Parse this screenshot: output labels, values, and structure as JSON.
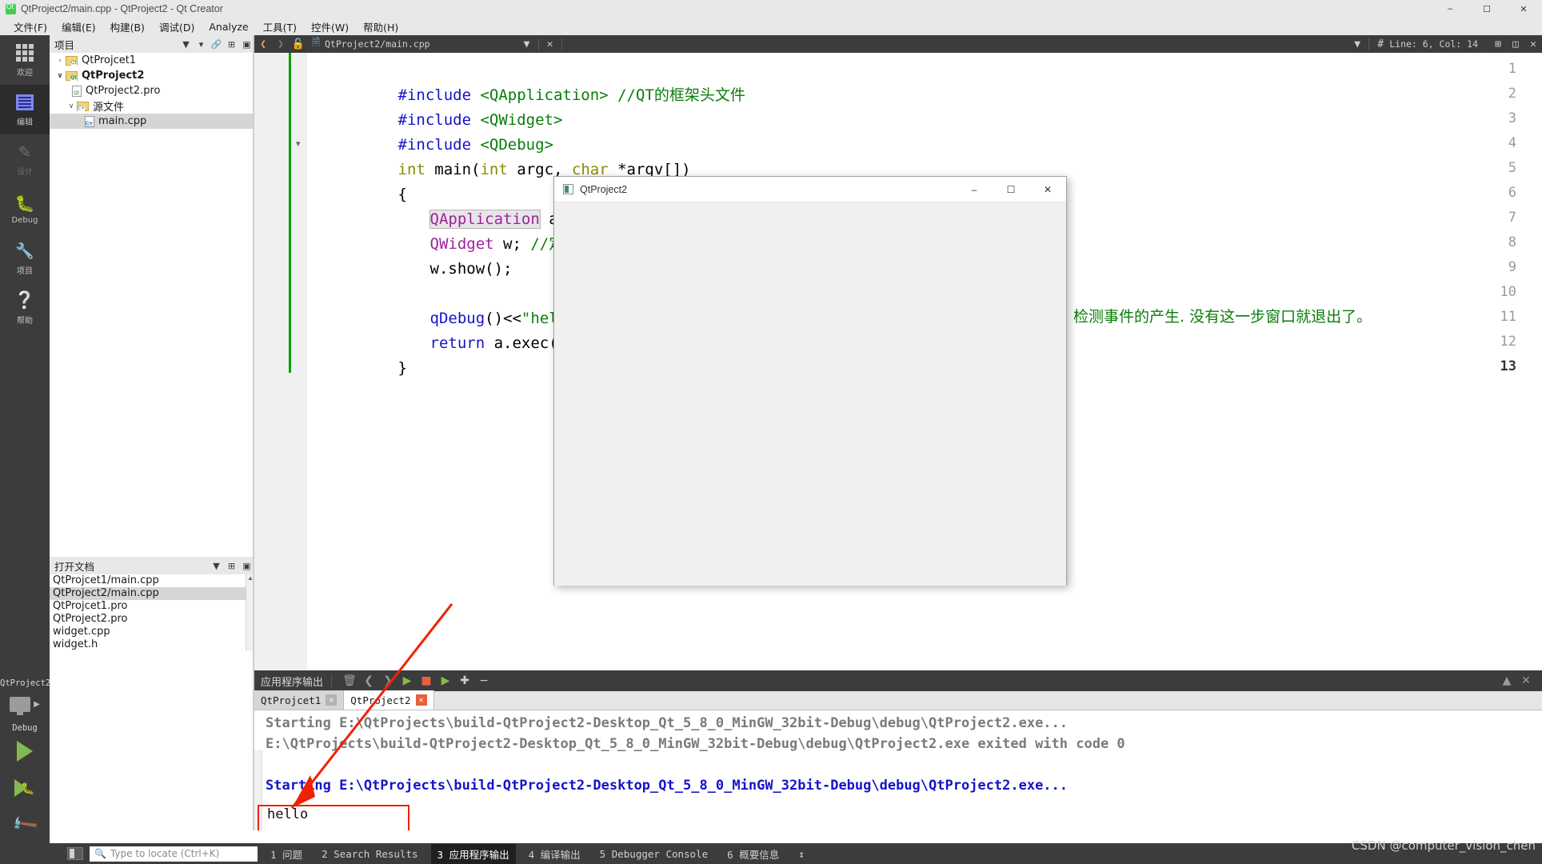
{
  "window": {
    "title": "QtProject2/main.cpp - QtProject2 - Qt Creator",
    "minimize": "–",
    "maximize": "☐",
    "close": "✕"
  },
  "menubar": [
    {
      "label": "文件(F)"
    },
    {
      "label": "编辑(E)"
    },
    {
      "label": "构建(B)"
    },
    {
      "label": "调试(D)"
    },
    {
      "label": "Analyze"
    },
    {
      "label": "工具(T)"
    },
    {
      "label": "控件(W)"
    },
    {
      "label": "帮助(H)"
    }
  ],
  "modebar": {
    "items": [
      {
        "label": "欢迎",
        "icon": "grid-icon"
      },
      {
        "label": "编辑",
        "icon": "edit-icon"
      },
      {
        "label": "设计",
        "icon": "pencil-icon"
      },
      {
        "label": "Debug",
        "icon": "bug-icon"
      },
      {
        "label": "项目",
        "icon": "wrench-icon"
      },
      {
        "label": "帮助",
        "icon": "question-icon"
      }
    ],
    "kit": {
      "project": "QtProject2",
      "config": "Debug"
    }
  },
  "projects_panel": {
    "title": "项目",
    "tree": [
      {
        "label": "QtProjcet1",
        "depth": 0,
        "arrow": "›",
        "icon": "qt-folder-icon",
        "bold": false,
        "selected": false
      },
      {
        "label": "QtProject2",
        "depth": 0,
        "arrow": "∨",
        "icon": "qt-folder-icon",
        "bold": true,
        "selected": false
      },
      {
        "label": "QtProject2.pro",
        "depth": 1,
        "arrow": "",
        "icon": "pro-file-icon",
        "bold": false,
        "selected": false
      },
      {
        "label": "源文件",
        "depth": 1,
        "arrow": "∨",
        "icon": "src-folder-icon",
        "bold": false,
        "selected": false
      },
      {
        "label": "main.cpp",
        "depth": 2,
        "arrow": "",
        "icon": "cpp-file-icon",
        "bold": false,
        "selected": true
      }
    ]
  },
  "opendocs_panel": {
    "title": "打开文档",
    "items": [
      {
        "label": "QtProjcet1/main.cpp",
        "selected": false
      },
      {
        "label": "QtProject2/main.cpp",
        "selected": true
      },
      {
        "label": "QtProjcet1.pro",
        "selected": false
      },
      {
        "label": "QtProject2.pro",
        "selected": false
      },
      {
        "label": "widget.cpp",
        "selected": false
      },
      {
        "label": "widget.h",
        "selected": false
      }
    ]
  },
  "editor_toolbar": {
    "current_file": "QtProject2/main.cpp",
    "line_col": "Line: 6, Col: 14",
    "hash": "#"
  },
  "editor": {
    "lines": [
      {
        "n": "1",
        "fold": false,
        "cur": false
      },
      {
        "n": "2",
        "fold": false,
        "cur": false
      },
      {
        "n": "3",
        "fold": false,
        "cur": false
      },
      {
        "n": "4",
        "fold": true,
        "cur": false
      },
      {
        "n": "5",
        "fold": false,
        "cur": false
      },
      {
        "n": "6",
        "fold": false,
        "cur": false
      },
      {
        "n": "7",
        "fold": false,
        "cur": false
      },
      {
        "n": "8",
        "fold": false,
        "cur": false
      },
      {
        "n": "9",
        "fold": false,
        "cur": false
      },
      {
        "n": "10",
        "fold": false,
        "cur": false
      },
      {
        "n": "11",
        "fold": false,
        "cur": false
      },
      {
        "n": "12",
        "fold": false,
        "cur": false
      },
      {
        "n": "13",
        "fold": false,
        "cur": true
      }
    ],
    "code": {
      "l1_inc": "#include",
      "l1_hdr": " <QApplication> ",
      "l1_cmt": "//QT的框架头文件",
      "l2_inc": "#include",
      "l2_hdr": " <QWidget>",
      "l3_inc": "#include",
      "l3_hdr": " <QDebug>",
      "l4_int": "int",
      "l4_main": " main(",
      "l4_int2": "int",
      "l4_argc": " argc, ",
      "l4_char": "char",
      "l4_argv": " *argv[])",
      "l5": "{",
      "l6_cls": "QApplication",
      "l6_rest": " a(a",
      "l7_cls": "QWidget",
      "l7_var": " w; ",
      "l7_cmt": "//定义",
      "l8": "w.show();",
      "l10_fn": "qDebug",
      "l10_op": "()<<",
      "l10_str": "\"hello",
      "l11_ret": "return",
      "l11_rest": " a.exec()",
      "l12": "}"
    },
    "annotation": "检测事件的产生. 没有这一步窗口就退出了。"
  },
  "popup": {
    "title": "QtProject2",
    "minimize": "–",
    "maximize": "☐",
    "close": "✕"
  },
  "output_panel": {
    "title": "应用程序输出",
    "tabs": [
      {
        "label": "QtProjcet1",
        "active": false
      },
      {
        "label": "QtProject2",
        "active": true
      }
    ],
    "lines": [
      {
        "text": "Starting E:\\QtProjects\\build-QtProject2-Desktop_Qt_5_8_0_MinGW_32bit-Debug\\debug\\QtProject2.exe...",
        "color": "gray"
      },
      {
        "text": "E:\\QtProjects\\build-QtProject2-Desktop_Qt_5_8_0_MinGW_32bit-Debug\\debug\\QtProject2.exe exited with code 0",
        "color": "gray"
      },
      {
        "text": "Starting E:\\QtProjects\\build-QtProject2-Desktop_Qt_5_8_0_MinGW_32bit-Debug\\debug\\QtProject2.exe...",
        "color": "blue"
      },
      {
        "text": "hello",
        "color": "black"
      }
    ]
  },
  "statusbar": {
    "locate_placeholder": "Type to locate (Ctrl+K)",
    "panes": [
      {
        "num": "1",
        "label": "问题",
        "active": false
      },
      {
        "num": "2",
        "label": "Search Results",
        "active": false
      },
      {
        "num": "3",
        "label": "应用程序输出",
        "active": true
      },
      {
        "num": "4",
        "label": "编译输出",
        "active": false
      },
      {
        "num": "5",
        "label": "Debugger Console",
        "active": false
      },
      {
        "num": "6",
        "label": "概要信息",
        "active": false
      }
    ]
  },
  "watermark": "CSDN @computer_vision_chen",
  "colors": {
    "accent_green": "#0a7d0a",
    "keyword_blue": "#1414c8",
    "class_purple": "#a020a0",
    "annotation_red": "#ee2200",
    "dark_chrome": "#3c3c3c"
  }
}
